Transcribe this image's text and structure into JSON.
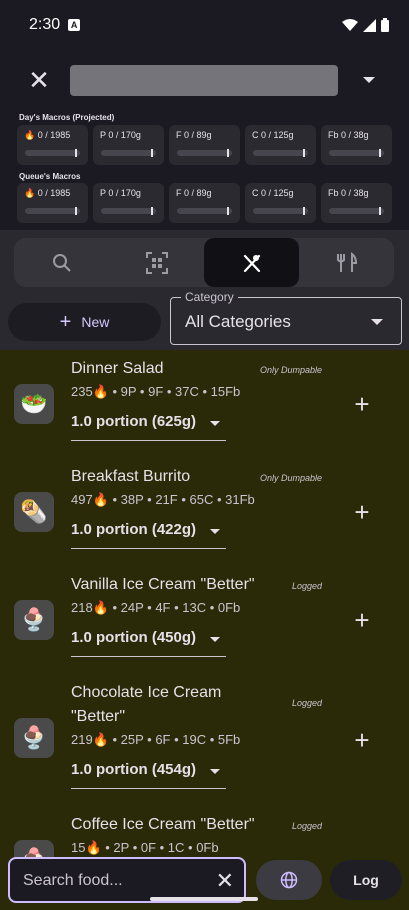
{
  "status": {
    "time": "2:30"
  },
  "macros": {
    "day_label": "Day's Macros (Projected)",
    "queue_label": "Queue's Macros",
    "day_chips": [
      "🔥 0 / 1985",
      "P 0 / 170g",
      "F 0 / 89g",
      "C 0 / 125g",
      "Fb 0 / 38g"
    ],
    "queue_chips": [
      "🔥 0 / 1985",
      "P 0 / 170g",
      "F 0 / 89g",
      "C 0 / 125g",
      "Fb 0 / 38g"
    ]
  },
  "controls": {
    "new_label": "New",
    "category_legend": "Category",
    "category_value": "All Categories"
  },
  "foods": [
    {
      "name": "Dinner Salad",
      "tag": "Only Dumpable",
      "macros": "235🔥 • 9P • 9F • 37C • 15Fb",
      "portion": "1.0 portion (625g)",
      "icon": "🥗"
    },
    {
      "name": "Breakfast Burrito",
      "tag": "Only Dumpable",
      "macros": "497🔥 • 38P • 21F • 65C • 31Fb",
      "portion": "1.0 portion (422g)",
      "icon": "🌯"
    },
    {
      "name": "Vanilla Ice Cream \"Better\"",
      "tag": "Logged",
      "macros": "218🔥 • 24P • 4F • 13C • 0Fb",
      "portion": "1.0 portion (450g)",
      "icon": "🍨"
    },
    {
      "name": "Chocolate Ice Cream \"Better\"",
      "tag": "Logged",
      "macros": "219🔥 • 25P • 6F • 19C • 5Fb",
      "portion": "1.0 portion (454g)",
      "icon": "🍨"
    },
    {
      "name": "Coffee Ice Cream \"Better\"",
      "tag": "Logged",
      "macros": "15🔥 • 2P • 0F • 1C • 0Fb",
      "portion": "",
      "icon": "🍨"
    }
  ],
  "bottom": {
    "search_placeholder": "Search food...",
    "log_label": "Log"
  }
}
